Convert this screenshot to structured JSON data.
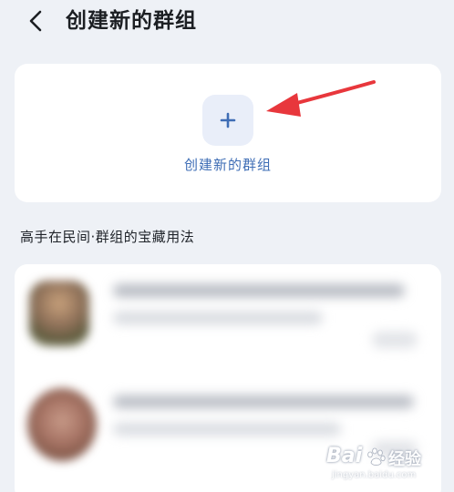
{
  "header": {
    "back_icon": "chevron-left-icon",
    "title": "创建新的群组"
  },
  "create_card": {
    "plus_icon": "plus-icon",
    "label": "创建新的群组",
    "annotation": "red-arrow"
  },
  "section": {
    "title": "高手在民间·群组的宝藏用法"
  },
  "list": {
    "items": [
      {
        "avatar": "avatar"
      },
      {
        "avatar": "avatar"
      }
    ]
  },
  "watermark": {
    "brand": "Bai",
    "brand_cn": "经验",
    "url": "jingyan.baidu.com"
  },
  "colors": {
    "background": "#eef1f6",
    "card": "#ffffff",
    "accent": "#3e6db5",
    "arrow": "#e8373c"
  }
}
